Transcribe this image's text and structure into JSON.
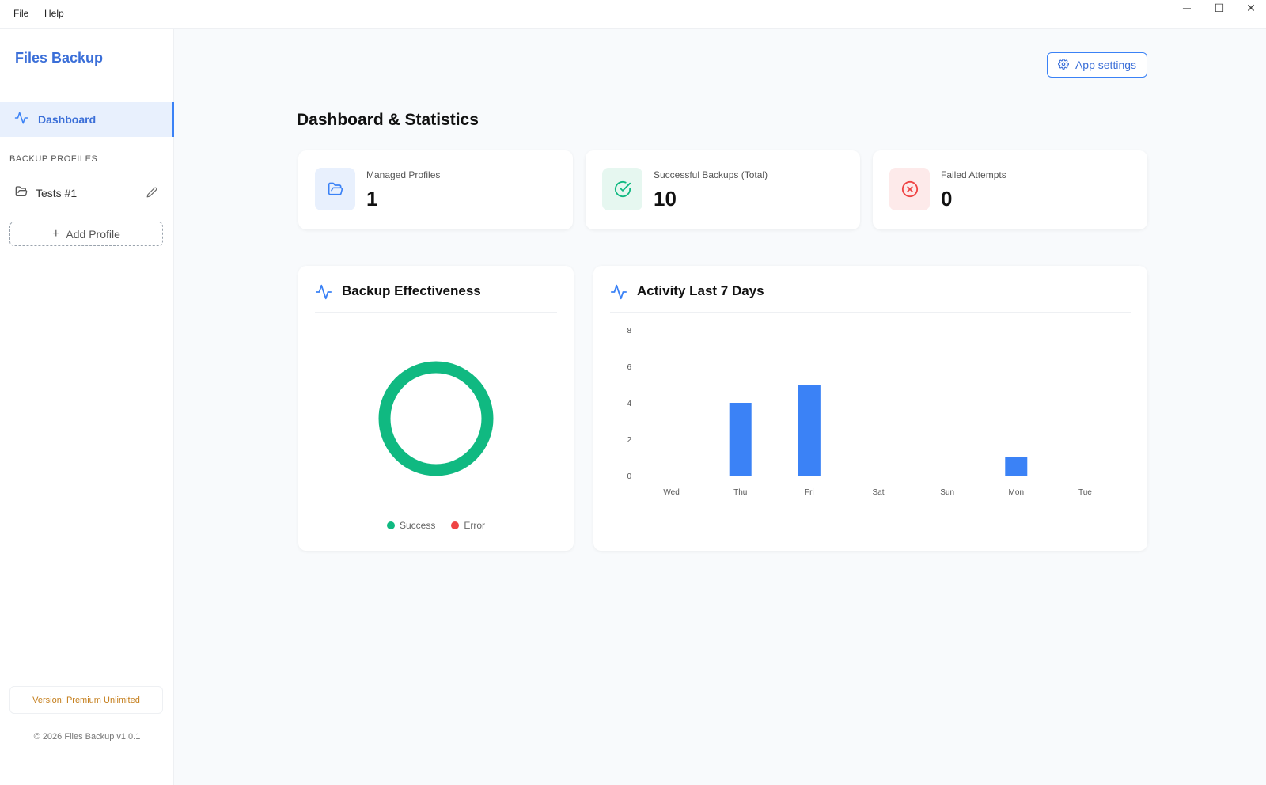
{
  "menu": {
    "file": "File",
    "help": "Help"
  },
  "window_controls": {
    "minimize": "─",
    "maximize": "☐",
    "close": "✕"
  },
  "sidebar": {
    "brand": "Files Backup",
    "nav": {
      "dashboard": "Dashboard"
    },
    "section_title": "BACKUP PROFILES",
    "profiles": [
      {
        "label": "Tests #1"
      }
    ],
    "add_profile": "Add Profile",
    "version": "Version: Premium Unlimited",
    "copyright": "© 2026 Files Backup v1.0.1"
  },
  "header": {
    "settings_label": "App settings"
  },
  "page": {
    "title": "Dashboard & Statistics"
  },
  "stats": [
    {
      "label": "Managed Profiles",
      "value": "1",
      "icon": "folder-icon",
      "color": "#3b82f6",
      "bg": "#e8f0fd"
    },
    {
      "label": "Successful Backups (Total)",
      "value": "10",
      "icon": "check-circle-icon",
      "color": "#10b981",
      "bg": "#e6f7f0"
    },
    {
      "label": "Failed Attempts",
      "value": "0",
      "icon": "x-circle-icon",
      "color": "#ef4444",
      "bg": "#fdeaea"
    }
  ],
  "effectiveness": {
    "title": "Backup Effectiveness",
    "legend": [
      {
        "label": "Success",
        "color": "#10b981"
      },
      {
        "label": "Error",
        "color": "#ef4444"
      }
    ]
  },
  "activity": {
    "title": "Activity Last 7 Days"
  },
  "chart_data": [
    {
      "type": "pie",
      "title": "Backup Effectiveness",
      "categories": [
        "Success",
        "Error"
      ],
      "values": [
        10,
        0
      ],
      "colors": [
        "#10b981",
        "#ef4444"
      ],
      "legend": "bottom"
    },
    {
      "type": "bar",
      "title": "Activity Last 7 Days",
      "categories": [
        "Wed",
        "Thu",
        "Fri",
        "Sat",
        "Sun",
        "Mon",
        "Tue"
      ],
      "values": [
        0,
        4,
        5,
        0,
        0,
        1,
        0
      ],
      "yticks": [
        0,
        2,
        4,
        6,
        8
      ],
      "ylim": [
        0,
        8
      ],
      "color": "#3b82f6",
      "grid": false
    }
  ]
}
